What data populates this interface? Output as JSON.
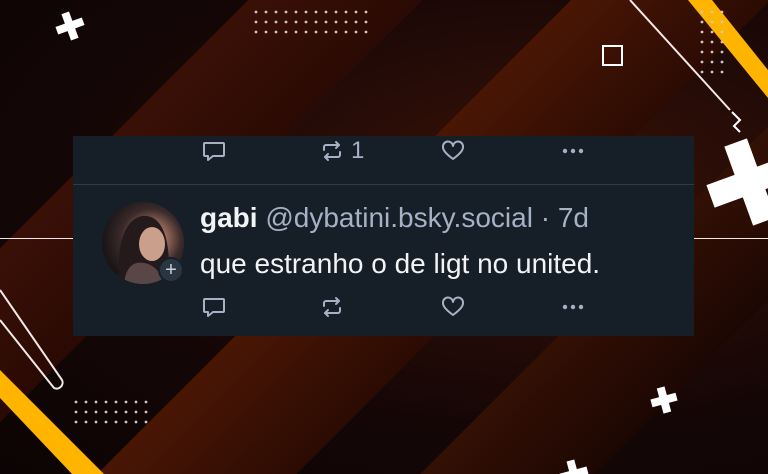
{
  "top_post": {
    "actions": {
      "repost_count": "1"
    }
  },
  "post": {
    "display_name": "gabi",
    "handle": "@dybatini.bsky.social",
    "separator": "·",
    "time": "7d",
    "text": "que estranho o de ligt no united."
  },
  "icons": [
    "reply-icon",
    "repost-icon",
    "like-icon",
    "more-icon",
    "follow-plus-icon"
  ],
  "colors": {
    "card_bg": "#161e27",
    "text_primary": "#f1f3f5",
    "text_secondary": "#a5b2c5",
    "accent_yellow": "#ffb400"
  }
}
